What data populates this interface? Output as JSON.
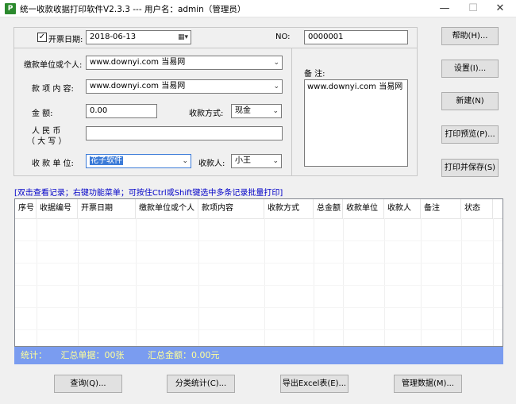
{
  "window": {
    "app_icon_letter": "P",
    "title": "统一收款收据打印软件V2.3.3 --- 用户名：admin（管理员）"
  },
  "header": {
    "invoice_date_checked": true,
    "invoice_date_label": "开票日期:",
    "invoice_date_value": "2018-06-13",
    "no_label": "NO:",
    "no_value": "0000001"
  },
  "form": {
    "payer_label": "缴款单位或个人:",
    "payer_value": "www.downyi.com  当易网",
    "item_label": "款 项 内 容:",
    "item_value": "www.downyi.com  当易网",
    "amount_label": "金      额:",
    "amount_value": "0.00",
    "pay_method_label": "收款方式:",
    "pay_method_value": "现金",
    "rmb_label_line1": "人   民   币",
    "rmb_label_line2": "（ 大   写 ）",
    "rmb_value": "",
    "unit_label": "收 款 单 位:",
    "unit_value": "花子软件",
    "receiver_label": "收款人:",
    "receiver_value": "小王"
  },
  "remarks": {
    "label": "备 注:",
    "value": "www.downyi.com  当易网"
  },
  "side_buttons": {
    "help": "帮助(H)...",
    "settings": "设置(I)...",
    "new": "新建(N)",
    "print_preview": "打印预览(P)...",
    "print_save": "打印并保存(S)"
  },
  "hint": "[双击查看记录；右键功能菜单；可按住Ctrl或Shift键选中多条记录批量打印]",
  "grid": {
    "columns": [
      "序号",
      "收据编号",
      "开票日期",
      "缴款单位或个人",
      "款项内容",
      "收款方式",
      "总金额",
      "收款单位",
      "收款人",
      "备注",
      "状态"
    ]
  },
  "status": {
    "stats_label": "统计：",
    "total_receipts": "汇总单据：00张",
    "total_amount": "汇总金额：0.00元"
  },
  "bottom_buttons": {
    "query": "查询(Q)...",
    "category_stats": "分类统计(C)...",
    "export_excel": "导出Excel表(E)...",
    "manage_data": "管理数据(M)..."
  }
}
